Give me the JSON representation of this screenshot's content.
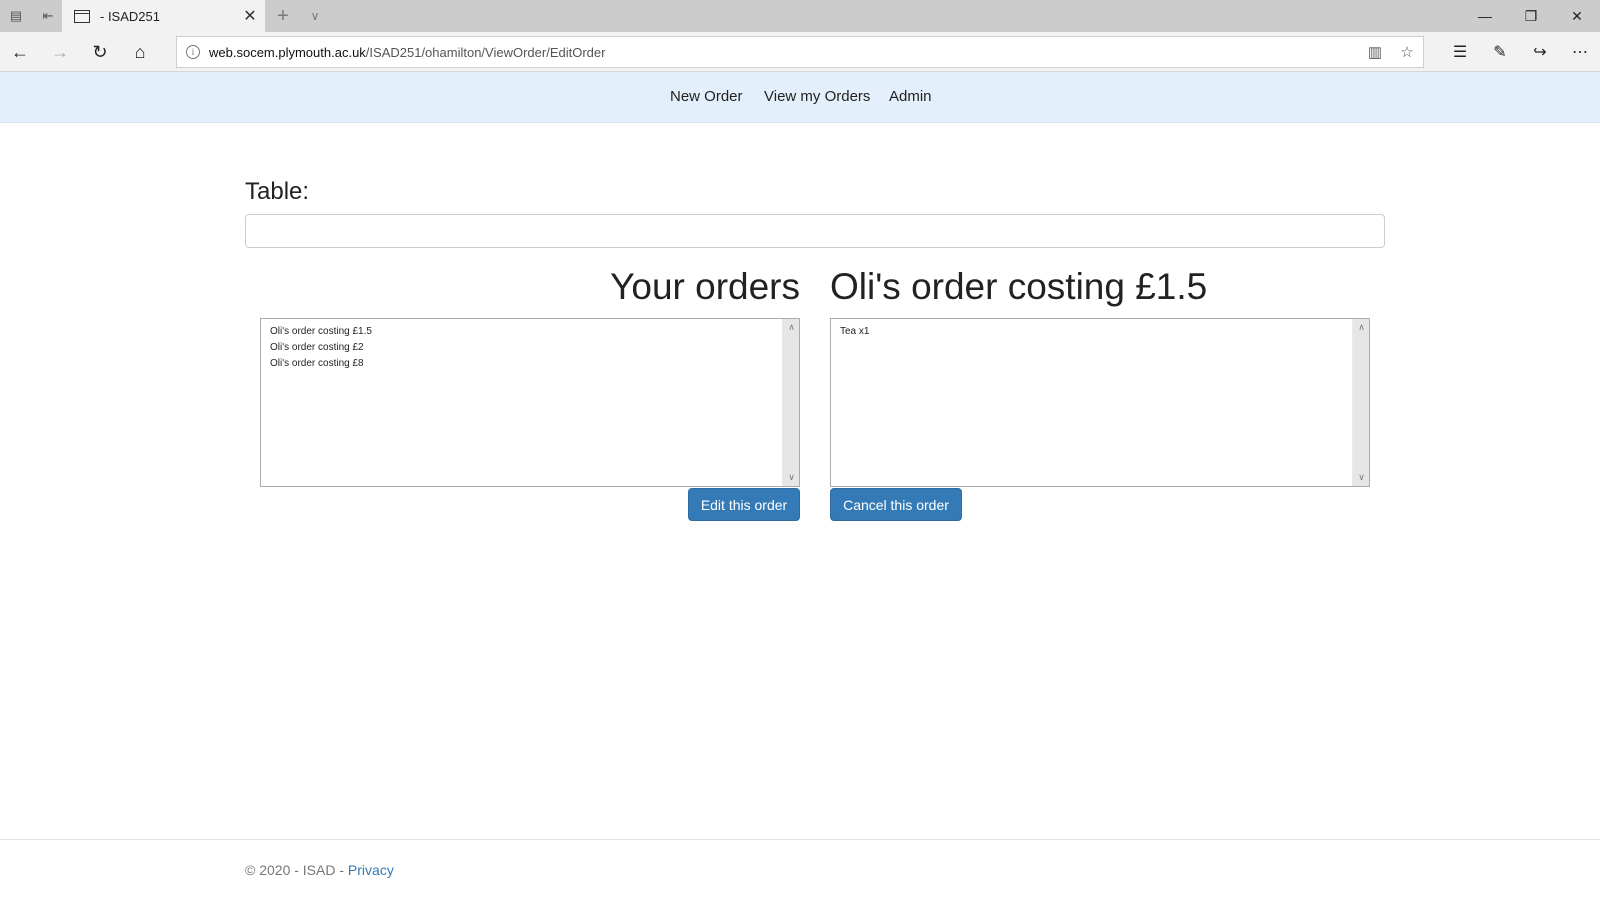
{
  "browser": {
    "tab_title": "- ISAD251",
    "new_tab_glyph": "+",
    "url_host": "web.socem.plymouth.ac.uk",
    "url_path": "/ISAD251/ohamilton/ViewOrder/EditOrder",
    "info_glyph": "i"
  },
  "nav": {
    "items": [
      "New Order",
      "View my Orders",
      "Admin"
    ]
  },
  "form": {
    "table_label": "Table:",
    "table_value": ""
  },
  "orders": {
    "heading": "Your orders",
    "items": [
      "Oli's order costing £1.5",
      "Oli's order costing £2",
      "Oli's order costing £8"
    ],
    "edit_button": "Edit this order"
  },
  "detail": {
    "heading": "Oli's order costing £1.5",
    "items": [
      "Tea x1"
    ],
    "cancel_button": "Cancel this order"
  },
  "footer": {
    "text": "© 2020 - ISAD - ",
    "privacy_link": "Privacy"
  },
  "colors": {
    "nav_bg": "#e3f0fb",
    "button_primary": "#337ab7",
    "link": "#337ab7"
  }
}
